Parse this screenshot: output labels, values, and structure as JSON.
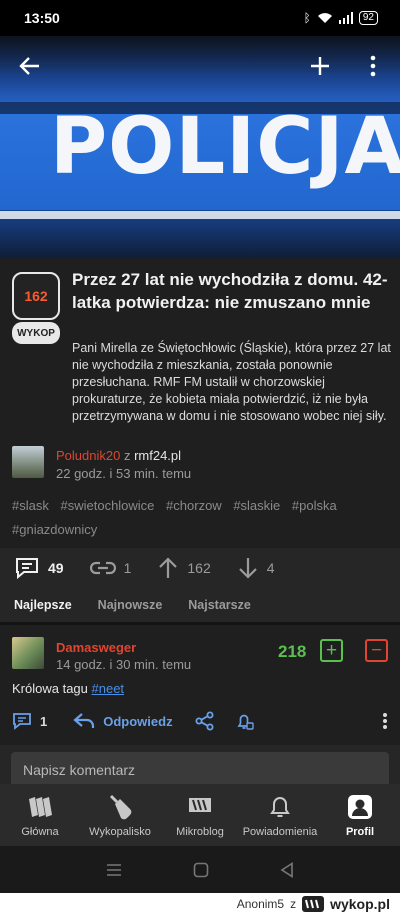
{
  "status": {
    "time": "13:50",
    "battery": "92"
  },
  "hero": {
    "text": "POLICJA"
  },
  "article": {
    "votes": "162",
    "wykop_label": "WYKOP",
    "title": "Przez 27 lat nie wychodziła z domu. 42-latka potwierdza: nie zmuszano mnie",
    "description": "Pani Mirella ze Świętochłowic (Śląskie), która przez 27 lat nie wychodziła z mieszkania, została ponownie przesłuchana. RMF FM ustalił w chorzowskiej prokuraturze, że kobieta miała potwierdzić, iż nie była przetrzymywana w domu i nie stosowano wobec niej siły.",
    "author": "Poludnik20",
    "author_joiner": "z",
    "source": "rmf24.pl",
    "time": "22 godz. i 53 min. temu",
    "tags": [
      "#slask",
      "#swietochlowice",
      "#chorzow",
      "#slaskie",
      "#polska",
      "#gniazdownicy"
    ]
  },
  "actions": {
    "comments": "49",
    "related": "1",
    "upvotes": "162",
    "downvotes": "4"
  },
  "sort": {
    "best": "Najlepsze",
    "newest": "Najnowsze",
    "oldest": "Najstarsze"
  },
  "comment": {
    "author": "Damasweger",
    "time": "14 godz. i 30 min. temu",
    "score": "218",
    "text": "Królowa tagu ",
    "hashtag": "#neet",
    "replies": "1",
    "reply_label": "Odpowiedz"
  },
  "input": {
    "placeholder": "Napisz komentarz"
  },
  "nav": [
    "Główna",
    "Wykopalisko",
    "Mikroblog",
    "Powiadomienia",
    "Profil"
  ],
  "footer": {
    "user": "Anonim5",
    "joiner": "z",
    "brand": "wykop.pl"
  }
}
